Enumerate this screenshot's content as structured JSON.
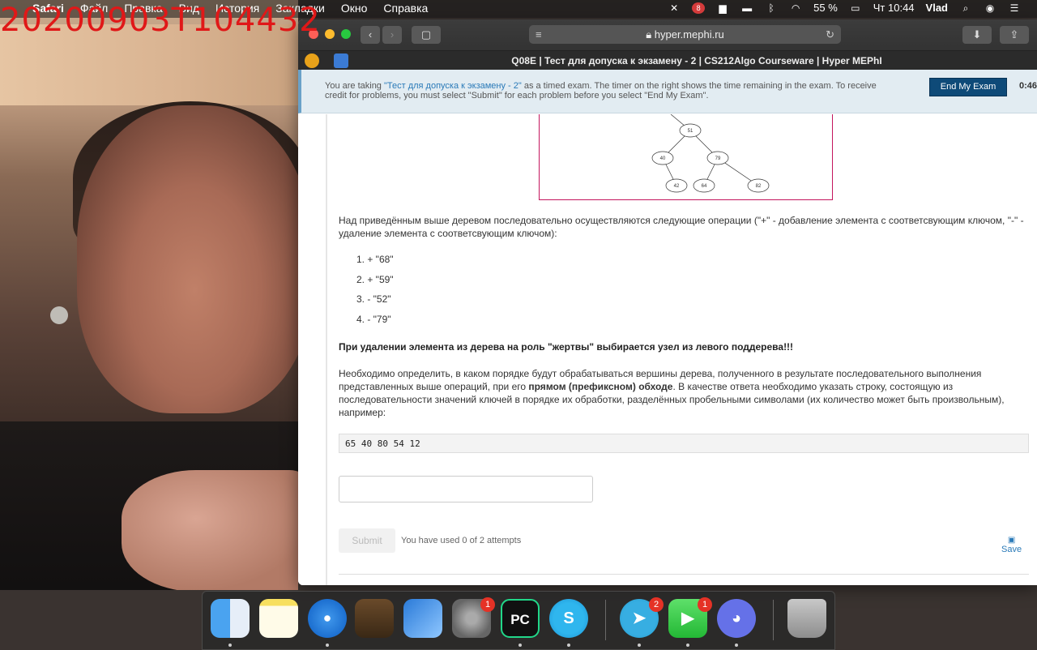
{
  "overlay": {
    "timestamp": "20200903T104432"
  },
  "menubar": {
    "apple": "",
    "items": [
      "Safari",
      "Файл",
      "Правка",
      "Вид",
      "История",
      "Закладки",
      "Окно",
      "Справка"
    ],
    "battery": "55 %",
    "clock": "Чт 10:44",
    "user": "Vlad",
    "notif_badge": "8"
  },
  "browser": {
    "url": "hyper.mephi.ru",
    "tab_title": "Q08E | Тест для допуска к экзамену - 2 | CS212Algo Courseware | Hyper MEPhI"
  },
  "banner": {
    "msg_prefix": "You are taking ",
    "exam_name": "\"Тест для допуска к экзамену - 2\"",
    "msg_suffix": " as a timed exam. The timer on the right shows the time remaining in the exam. To receive credit for problems, you must select \"Submit\" for each problem before you select \"End My Exam\".",
    "end_button": "End My Exam",
    "timer": "0:46:"
  },
  "tree": {
    "nodes": [
      {
        "id": "root",
        "label": "51"
      },
      {
        "id": "l",
        "label": "40"
      },
      {
        "id": "r",
        "label": "79"
      },
      {
        "id": "ll",
        "label": "42"
      },
      {
        "id": "rl",
        "label": "64"
      },
      {
        "id": "rr",
        "label": "82"
      }
    ]
  },
  "question": {
    "intro": "Над приведённым выше деревом последовательно осуществляются следующие операции (\"+\" - добавление элемента с соответсвующим ключом, \"-\" - удаление элемента с соответсвующим ключом):",
    "operations": [
      "1.  + \"68\"",
      "2.  + \"59\"",
      "3.  - \"52\"",
      "4.  - \"79\""
    ],
    "warning": "При удалении элемента из дерева на роль \"жертвы\" выбирается узел из левого поддерева!!!",
    "task_a": "Необходимо определить, в каком порядке будут обрабатываться вершины дерева, полученного в результате последовательного выполнения представленных выше операций, при его ",
    "task_bold": "прямом (префиксном) обходе",
    "task_b": ". В качестве ответа необходимо указать строку, состоящую из последовательности значений ключей в порядке их обработки, разделённых пробельными символами (их количество может быть произвольным), например:",
    "example": "65 40 80 54 12",
    "answer_value": ""
  },
  "actions": {
    "submit": "Submit",
    "attempts": "You have used 0 of 2 attempts",
    "save": "Save"
  },
  "dock": {
    "apps": [
      "finder",
      "notes",
      "safari",
      "guitar",
      "xcode",
      "system-preferences",
      "pycharm",
      "skype",
      "telegram",
      "facetime",
      "discord",
      "trash"
    ],
    "badges": {
      "system_preferences": "1",
      "telegram": "2",
      "facetime": "1"
    },
    "pycharm_label": "PC"
  }
}
